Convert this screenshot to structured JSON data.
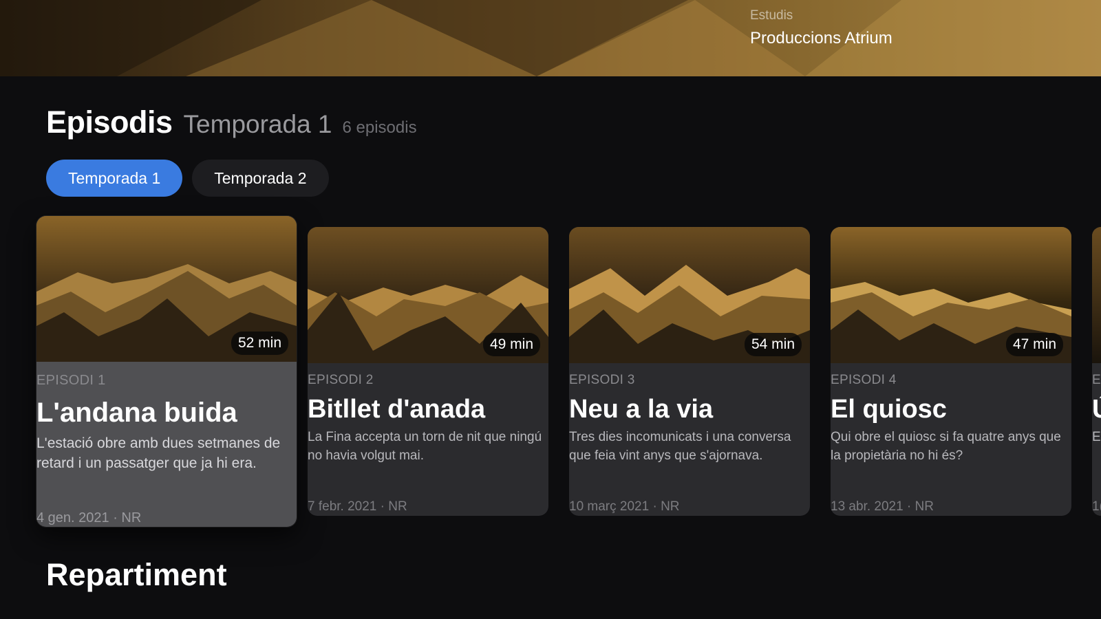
{
  "hero": {
    "studio_label": "Estudis",
    "studio_name": "Produccions Atrium"
  },
  "episodes_section": {
    "title": "Episodis",
    "season": "Temporada 1",
    "count": "6 episodis"
  },
  "season_tabs": [
    {
      "label": "Temporada 1",
      "active": true
    },
    {
      "label": "Temporada 2",
      "active": false
    }
  ],
  "episodes": [
    {
      "label": "EPISODI 1",
      "title": "L'andana buida",
      "duration": "52 min",
      "description": "L'estació obre amb dues setmanes de retard i un passatger que ja hi era.",
      "meta": "4 gen. 2021 · NR",
      "focused": true
    },
    {
      "label": "EPISODI 2",
      "title": "Bitllet d'anada",
      "duration": "49 min",
      "description": "La Fina accepta un torn de nit que ningú no havia volgut mai.",
      "meta": "7 febr. 2021 · NR",
      "focused": false
    },
    {
      "label": "EPISODI 3",
      "title": "Neu a la via",
      "duration": "54 min",
      "description": "Tres dies incomunicats i una conversa que feia vint anys que s'ajornava.",
      "meta": "10 març 2021 · NR",
      "focused": false
    },
    {
      "label": "EPISODI 4",
      "title": "El quiosc",
      "duration": "47 min",
      "description": "Qui obre el quiosc si fa quatre anys que la propietària no hi és?",
      "meta": "13 abr. 2021 · NR",
      "focused": false
    },
    {
      "label": "E",
      "title": "Ú",
      "description": "E h",
      "meta": "1(",
      "focused": false,
      "clipped": true
    }
  ],
  "cast_section": {
    "title": "Repartiment"
  },
  "colors": {
    "accent": "#3a7be0",
    "background": "#0d0d0f",
    "card": "#2b2b2e",
    "gold": "#c99a3c"
  }
}
